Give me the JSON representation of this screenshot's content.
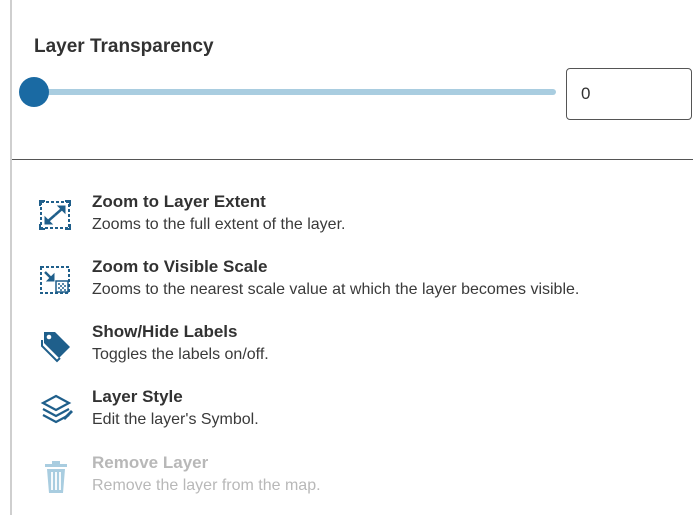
{
  "transparency": {
    "title": "Layer Transparency",
    "value": "0",
    "level_percent": 0
  },
  "actions": [
    {
      "label": "Zoom to Layer Extent",
      "description": "Zooms to the full extent of the layer.",
      "icon": "zoom-extent-icon",
      "enabled": true
    },
    {
      "label": "Zoom to Visible Scale",
      "description": "Zooms to the nearest scale value at which the layer becomes visible.",
      "icon": "zoom-scale-icon",
      "enabled": true
    },
    {
      "label": "Show/Hide Labels",
      "description": "Toggles the labels on/off.",
      "icon": "tag-icon",
      "enabled": true
    },
    {
      "label": "Layer Style",
      "description": "Edit the layer's Symbol.",
      "icon": "layers-icon",
      "enabled": true
    },
    {
      "label": "Remove Layer",
      "description": "Remove the layer from the map.",
      "icon": "trash-icon",
      "enabled": false
    }
  ],
  "colors": {
    "accent": "#1a6aa3",
    "track": "#a9cde0",
    "icon": "#1f5f8b",
    "disabled": "#b8b8b8"
  }
}
